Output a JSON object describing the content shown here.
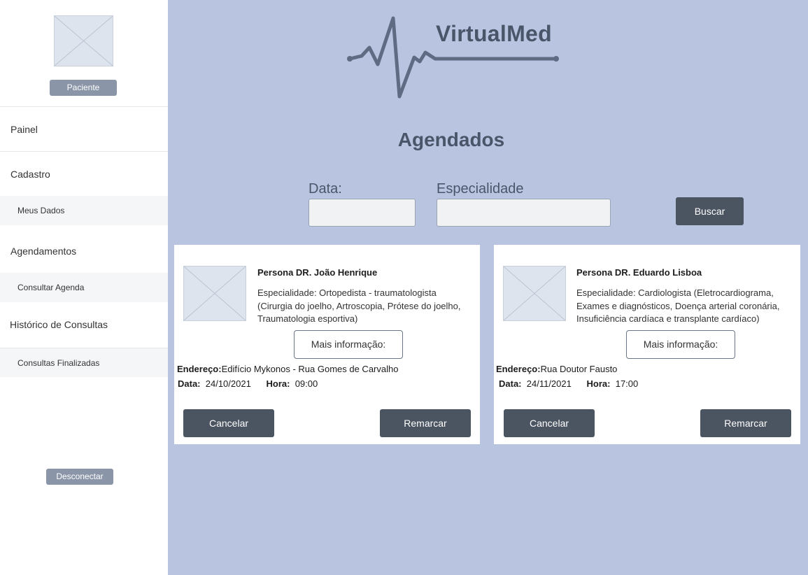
{
  "sidebar": {
    "user_button": "Paciente",
    "items": [
      {
        "label": "Painel",
        "type": "main"
      },
      {
        "label": "Cadastro",
        "type": "main"
      },
      {
        "label": "Meus Dados",
        "type": "sub"
      },
      {
        "label": "Agendamentos",
        "type": "main"
      },
      {
        "label": "Consultar Agenda",
        "type": "sub"
      },
      {
        "label": "Histórico de Consultas",
        "type": "main"
      },
      {
        "label": "Consultas Finalizadas",
        "type": "sub"
      }
    ],
    "logout_button": "Desconectar"
  },
  "header": {
    "logo_text": "VirtualMed",
    "page_title": "Agendados"
  },
  "search": {
    "date_label": "Data:",
    "date_value": "",
    "specialty_label": "Especialidade",
    "specialty_value": "",
    "button_label": "Buscar"
  },
  "appointments": [
    {
      "doctor": "Persona DR. João Henrique",
      "specialty": "Especialidade: Ortopedista - traumatologista (Cirurgia do joelho, Artroscopia, Prótese do joelho, Traumatologia esportiva)",
      "more_info": "Mais informação:",
      "address_label": "Endereço:",
      "address": "Edifício Mykonos - Rua Gomes de Carvalho",
      "date_label": "Data:",
      "date": "24/10/2021",
      "time_label": "Hora:",
      "time": "09:00",
      "cancel_label": "Cancelar",
      "reschedule_label": "Remarcar"
    },
    {
      "doctor": "Persona DR. Eduardo Lisboa",
      "specialty": "Especialidade: Cardiologista (Eletrocardiograma, Exames e diagnósticos, Doença arterial coronária, Insuficiência cardíaca e transplante cardíaco)",
      "more_info": "Mais informação:",
      "address_label": "Endereço:",
      "address": "Rua Doutor Fausto",
      "date_label": "Data:",
      "date": "24/11/2021",
      "time_label": "Hora:",
      "time": "17:00",
      "cancel_label": "Cancelar",
      "reschedule_label": "Remarcar"
    }
  ],
  "colors": {
    "background": "#b9c5e0",
    "sidebar": "#ffffff",
    "dark_button": "#4b5461",
    "accent_text": "#4a556a",
    "muted_button": "#8a95a8"
  }
}
